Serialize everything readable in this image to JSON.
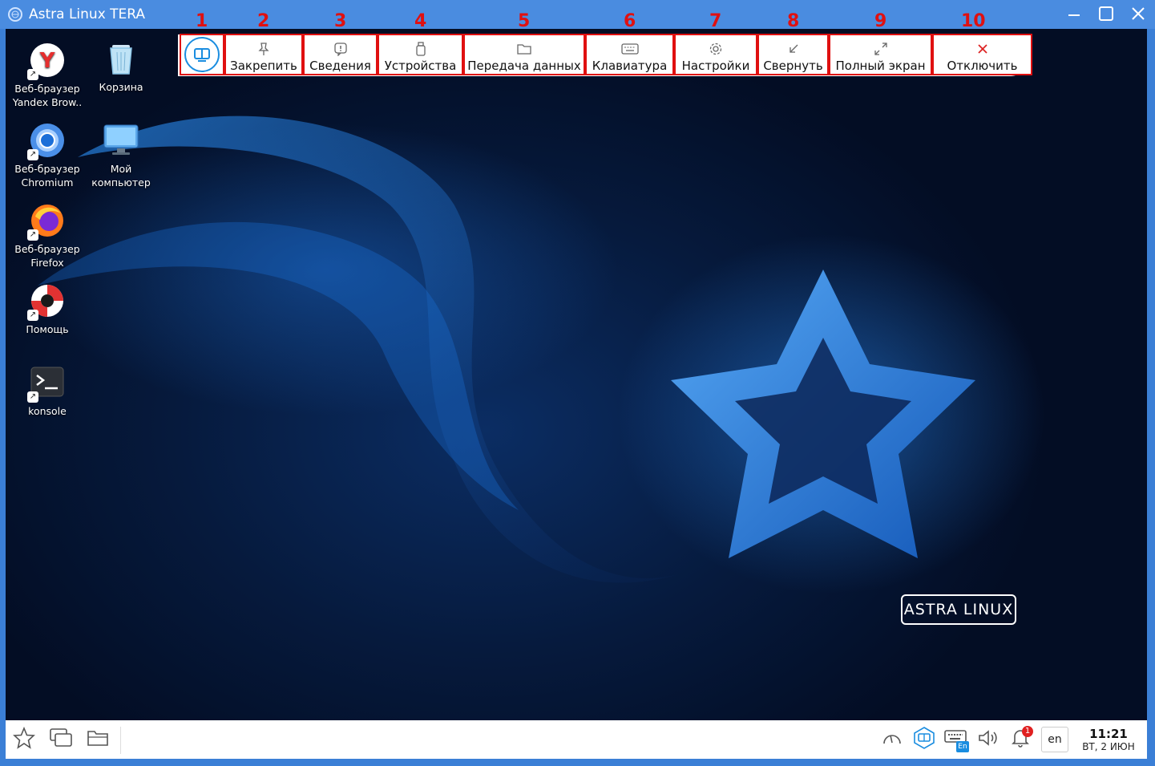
{
  "window": {
    "title": "Astra Linux TERA"
  },
  "desktop_icons": [
    {
      "label": "Веб-браузер Yandex Brow..",
      "icon": "yandex-browser-icon"
    },
    {
      "label": "Корзина",
      "icon": "trash-icon"
    },
    {
      "label": "Веб-браузер Chromium",
      "icon": "chromium-icon"
    },
    {
      "label": "Мой компьютер",
      "icon": "my-computer-icon"
    },
    {
      "label": "Веб-браузер Firefox",
      "icon": "firefox-icon"
    },
    {
      "label": "Помощь",
      "icon": "help-lifebuoy-icon"
    },
    {
      "label": "konsole",
      "icon": "terminal-icon"
    }
  ],
  "toolbar": {
    "numbers": [
      "1",
      "2",
      "3",
      "4",
      "5",
      "6",
      "7",
      "8",
      "9",
      "10"
    ],
    "buttons": [
      {
        "label": "Закрепить",
        "icon": "pin-icon"
      },
      {
        "label": "Сведения",
        "icon": "info-icon"
      },
      {
        "label": "Устройства",
        "icon": "usb-device-icon"
      },
      {
        "label": "Передача данных",
        "icon": "folder-icon"
      },
      {
        "label": "Клавиатура",
        "icon": "keyboard-icon"
      },
      {
        "label": "Настройки",
        "icon": "gear-icon"
      },
      {
        "label": "Свернуть",
        "icon": "minimize-arrow-icon"
      },
      {
        "label": "Полный экран",
        "icon": "fullscreen-icon"
      },
      {
        "label": "Отключить",
        "icon": "close-icon"
      }
    ]
  },
  "wallpaper": {
    "logo_text": "ASTRA LINUX"
  },
  "taskbar": {
    "language": "en",
    "time": "11:21",
    "date": "ВТ, 2 ИЮН",
    "notifications_count": "1",
    "keyboard_layout_badge": "En"
  },
  "colors": {
    "highlight": "#e01010",
    "accent": "#1a8de0",
    "titlebar": "#4a8ce0"
  }
}
